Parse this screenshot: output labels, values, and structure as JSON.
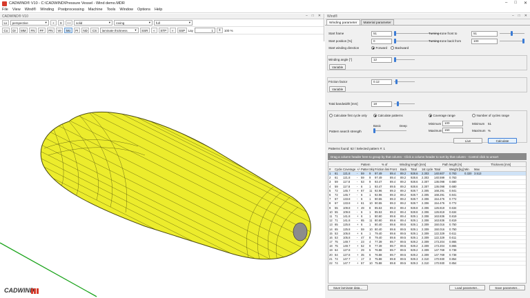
{
  "titlebar": {
    "title": "CADWIND® V10 - C:\\CADWIND\\Pressure Vessel - Wind demo.MDR"
  },
  "menu": [
    "File",
    "View",
    "Wind®",
    "Winding",
    "Postprocessing",
    "Machine",
    "Tools",
    "Window",
    "Options",
    "Help"
  ],
  "viewport": {
    "title": "CADWIND® V10",
    "toolbar_row1": {
      "lx_label": "Lx",
      "view_value": "perspective",
      "plus": "+",
      "x_label": "X",
      "plusplus": "++",
      "mode_value": "solid",
      "fiber_value": "roving",
      "range_value": "full"
    },
    "toolbar_row2": {
      "buttons": [
        "Co",
        "Dr",
        "MM",
        "FN",
        "PF",
        "PN",
        "Ve",
        "Mo",
        "PI",
        "ND",
        "CS"
      ],
      "active": "Mo",
      "thick_value": "laminate thickness",
      "ssr": "SSR",
      "stp": "STP",
      "ssp": "SSP",
      "layer_label": "Lay",
      "layer_value": "1",
      "zoom_value": "100 %"
    },
    "logo_text": "CADWIND",
    "colors": {
      "vessel": "#ecec2c",
      "vessel_line": "#5d5d10",
      "axis_green": "#1aa31a",
      "axis_red": "#d81b1b",
      "boss": "#8c8c8c"
    }
  },
  "settings": {
    "title": "Wind®",
    "tabs": [
      "Winding parameter",
      "Material parameter"
    ],
    "start_frame": {
      "label": "Start frame",
      "value": "51"
    },
    "start_position": {
      "label": "Start position [%]",
      "value": "0"
    },
    "start_dir": {
      "label": "Start winding direction",
      "opt1": "Forward",
      "opt2": "Backward"
    },
    "turn_front": {
      "label": "Turning zone front to",
      "value": "51"
    },
    "turn_back": {
      "label": "Turning zone back from",
      "value": "100"
    },
    "winding_angle": {
      "label": "Winding angle [°]",
      "value": "12",
      "btn": "Variable"
    },
    "friction": {
      "label": "Friction factor",
      "value": "0.12",
      "btn": "Variable"
    },
    "bandwidth": {
      "label": "Total bandwidth [mm]",
      "value": "18"
    },
    "calc_first": "Calculate first cycle only",
    "calc_patterns": "Calculate patterns",
    "coverage_range": "Coverage range",
    "num_cycles": "Number of cycles range",
    "min_label": "Minimum",
    "min_cov": "100",
    "min_cyc": "51",
    "max_label": "Maximum",
    "max_cov": "150",
    "max_cyc": "%",
    "search_strength": "Pattern search strength",
    "fast": "Basic",
    "deep": "Deep",
    "live_btn": "Live",
    "calc_btn": "Calculate",
    "patterns_found": "Patterns found: 62 / Selected pattern #: 1",
    "hint": "Drag a column header here to group by that column - Click a column header to sort by that column - Control click to unsort",
    "grid_group_headers": [
      "Pattern",
      "% of",
      "Winding length [mm]",
      "Path length [m]",
      "Thickness [mm]"
    ],
    "grid_headers": [
      "#",
      "Cycles",
      "Coverage [%]",
      "+/-",
      "Pattern",
      "Skip",
      "Friction limit",
      "Front",
      "Back",
      "Total",
      "1st cycle",
      "Total",
      "Weight [kg]",
      "Min",
      "Max"
    ],
    "rows": [
      [
        "1",
        "61",
        "121.8",
        "-",
        "59",
        "9",
        "97.49",
        "89.4",
        "89.2",
        "928.6",
        "2.303",
        "140.607",
        "0.763",
        "0.320",
        "3.513"
      ],
      [
        "2",
        "61",
        "121.8",
        "-",
        "59",
        "9",
        "97.49",
        "89.4",
        "89.2",
        "928.6",
        "2.303",
        "140.599",
        "0.763",
        "",
        ""
      ],
      [
        "3",
        "59",
        "117.8",
        "-",
        "53",
        "9",
        "93.47",
        "89.4",
        "89.2",
        "928.6",
        "2.307",
        "136.098",
        "0.680",
        "",
        ""
      ],
      [
        "4",
        "59",
        "117.8",
        "-",
        "6",
        "1",
        "93.47",
        "89.5",
        "89.2",
        "928.6",
        "2.307",
        "136.098",
        "0.680",
        "",
        ""
      ],
      [
        "5",
        "72",
        "145.7",
        "+",
        "67",
        "11",
        "92.96",
        "89.3",
        "89.2",
        "928.7",
        "2.305",
        "168.291",
        "0.841",
        "",
        ""
      ],
      [
        "6",
        "72",
        "145.7",
        "-",
        "6",
        "1",
        "92.96",
        "89.3",
        "89.2",
        "928.7",
        "2.305",
        "168.291",
        "0.841",
        "",
        ""
      ],
      [
        "7",
        "67",
        "133.8",
        "-",
        "6",
        "1",
        "90.55",
        "89.3",
        "89.2",
        "928.7",
        "2.306",
        "154.476",
        "0.772",
        "",
        ""
      ],
      [
        "8",
        "67",
        "133.8",
        "+",
        "61",
        "10",
        "90.55",
        "89.3",
        "89.2",
        "928.7",
        "2.306",
        "154.476",
        "0.772",
        "",
        ""
      ],
      [
        "9",
        "55",
        "109.8",
        "+",
        "49",
        "8",
        "85.53",
        "89.3",
        "89.4",
        "928.8",
        "2.306",
        "126.819",
        "0.634",
        "",
        ""
      ],
      [
        "10",
        "55",
        "109.8",
        "-",
        "6",
        "1",
        "85.53",
        "89.3",
        "89.4",
        "928.8",
        "2.306",
        "126.819",
        "0.634",
        "",
        ""
      ],
      [
        "11",
        "71",
        "141.8",
        "+",
        "6",
        "1",
        "80.60",
        "89.6",
        "89.4",
        "929.1",
        "2.308",
        "163.836",
        "0.819",
        "",
        ""
      ],
      [
        "12",
        "71",
        "141.8",
        "-",
        "65",
        "11",
        "80.60",
        "89.6",
        "89.4",
        "929.1",
        "2.308",
        "163.836",
        "0.819",
        "",
        ""
      ],
      [
        "13",
        "65",
        "125.8",
        "+",
        "6",
        "1",
        "80.40",
        "89.6",
        "89.5",
        "929.1",
        "2.309",
        "150.016",
        "0.750",
        "",
        ""
      ],
      [
        "14",
        "65",
        "125.8",
        "-",
        "59",
        "10",
        "80.40",
        "89.6",
        "89.5",
        "929.1",
        "2.309",
        "150.016",
        "0.750",
        "",
        ""
      ],
      [
        "15",
        "53",
        "105.8",
        "+",
        "6",
        "1",
        "79.40",
        "89.6",
        "89.5",
        "929.1",
        "2.309",
        "122.329",
        "0.611",
        "",
        ""
      ],
      [
        "16",
        "53",
        "105.8",
        "-",
        "47",
        "8",
        "79.40",
        "89.6",
        "89.5",
        "929.1",
        "2.309",
        "122.329",
        "0.611",
        "",
        ""
      ],
      [
        "17",
        "75",
        "149.7",
        "-",
        "23",
        "4",
        "77.39",
        "89.7",
        "89.5",
        "929.2",
        "2.309",
        "173.204",
        "0.865",
        "",
        ""
      ],
      [
        "18",
        "75",
        "149.7",
        "+",
        "52",
        "9",
        "77.39",
        "89.7",
        "89.5",
        "929.2",
        "2.309",
        "173.204",
        "0.865",
        "",
        ""
      ],
      [
        "19",
        "64",
        "127.8",
        "-",
        "29",
        "5",
        "76.88",
        "89.7",
        "89.5",
        "929.2",
        "2.309",
        "147.769",
        "0.738",
        "",
        ""
      ],
      [
        "20",
        "64",
        "127.8",
        "+",
        "35",
        "6",
        "76.88",
        "89.7",
        "89.5",
        "929.2",
        "2.309",
        "147.769",
        "0.738",
        "",
        ""
      ],
      [
        "21",
        "74",
        "147.7",
        "-",
        "17",
        "3",
        "75.88",
        "89.8",
        "89.5",
        "929.3",
        "2.310",
        "170.930",
        "0.854",
        "",
        ""
      ],
      [
        "22",
        "74",
        "147.7",
        "+",
        "57",
        "10",
        "75.88",
        "89.8",
        "89.5",
        "929.3",
        "2.310",
        "170.930",
        "0.854",
        "",
        ""
      ]
    ],
    "save_laminate": "Save laminate data...",
    "load_param": "Load parameter...",
    "save_param": "Save parameter..."
  }
}
